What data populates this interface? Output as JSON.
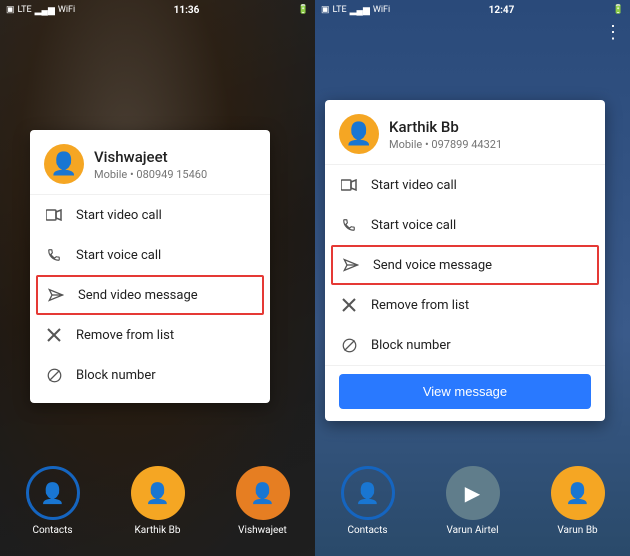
{
  "left": {
    "statusBar": {
      "time": "11:36",
      "icons": [
        "sim",
        "wifi",
        "signal",
        "battery"
      ]
    },
    "card": {
      "contactName": "Vishwajeet",
      "contactPhone": "Mobile • 080949 15460",
      "menuItems": [
        {
          "id": "video-call",
          "label": "Start video call",
          "icon": "video-icon"
        },
        {
          "id": "voice-call",
          "label": "Start voice call",
          "icon": "phone-icon"
        },
        {
          "id": "send-video",
          "label": "Send video message",
          "icon": "send-icon",
          "highlighted": true
        },
        {
          "id": "remove",
          "label": "Remove from list",
          "icon": "x-icon"
        },
        {
          "id": "block",
          "label": "Block number",
          "icon": "block-icon"
        }
      ]
    },
    "tabs": [
      {
        "id": "contacts",
        "label": "Contacts",
        "type": "contacts-outline"
      },
      {
        "id": "karthik",
        "label": "Karthik Bb",
        "type": "yellow"
      },
      {
        "id": "vishwajeet",
        "label": "Vishwajeet",
        "type": "orange"
      }
    ]
  },
  "right": {
    "statusBar": {
      "time": "12:47",
      "icons": [
        "sim",
        "wifi",
        "signal",
        "battery"
      ]
    },
    "threeDotsLabel": "⋮",
    "card": {
      "contactName": "Karthik Bb",
      "contactPhone": "Mobile • 097899 44321",
      "menuItems": [
        {
          "id": "video-call",
          "label": "Start video call",
          "icon": "video-icon"
        },
        {
          "id": "voice-call",
          "label": "Start voice call",
          "icon": "phone-icon"
        },
        {
          "id": "send-voice",
          "label": "Send voice message",
          "icon": "send-icon",
          "highlighted": true
        },
        {
          "id": "remove",
          "label": "Remove from list",
          "icon": "x-icon"
        },
        {
          "id": "block",
          "label": "Block number",
          "icon": "block-icon"
        }
      ],
      "viewMessageLabel": "View message"
    },
    "tabs": [
      {
        "id": "contacts",
        "label": "Contacts",
        "type": "contacts-outline"
      },
      {
        "id": "varun-airtel",
        "label": "Varun Airtel",
        "type": "gray"
      },
      {
        "id": "varun-bb",
        "label": "Varun Bb",
        "type": "gold"
      }
    ]
  }
}
